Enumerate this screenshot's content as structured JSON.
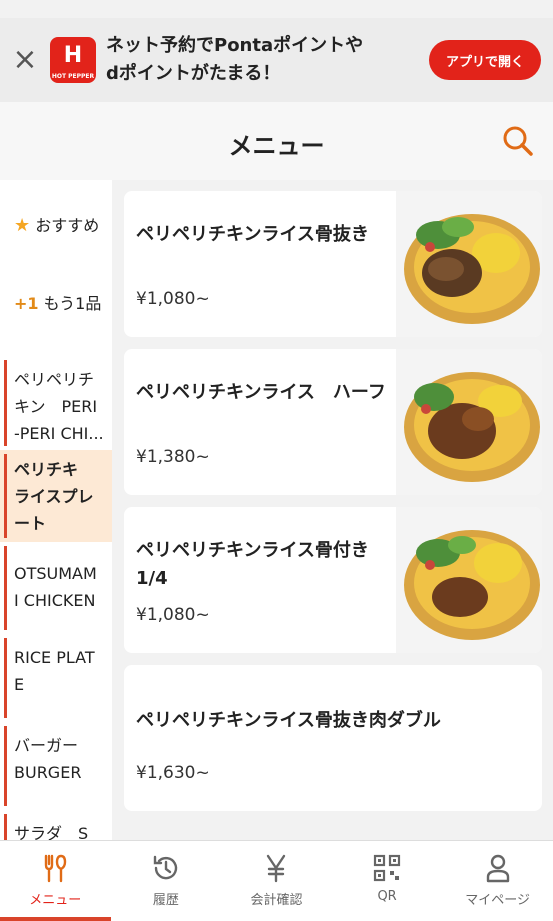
{
  "banner": {
    "app_icon_letter": "H",
    "app_icon_sub": "HOT PEPPER",
    "message_line1": "ネット予約でPontaポイントや",
    "message_line2": "dポイントがたまる！",
    "open_app_label": "アプリで開く",
    "close_glyph": "×"
  },
  "header": {
    "title": "メニュー"
  },
  "sidebar": {
    "recommend": "おすすめ",
    "one_more_prefix": "+1",
    "one_more": "もう1品",
    "items": [
      {
        "line1": "ペリペリチ",
        "line2": "キン　PERI",
        "line3": "-PERI CHI..."
      },
      {
        "line1": "ペリチキ",
        "line2": "ライスプレ",
        "line3": "ート"
      },
      {
        "line1": "OTSUMAM",
        "line2": "I CHICKEN"
      },
      {
        "line1": "RICE PLAT",
        "line2": "E"
      },
      {
        "line1": "バーガー",
        "line2": "BURGER"
      },
      {
        "line1": "サラダ　S"
      }
    ]
  },
  "menu": [
    {
      "name": "ペリペリチキンライス骨抜き",
      "price": "¥1,080~"
    },
    {
      "name": "ペリペリチキンライス　ハーフ",
      "price": "¥1,380~"
    },
    {
      "name": "ペリペリチキンライス骨付き1/4",
      "price": "¥1,080~"
    },
    {
      "name": "ペリペリチキンライス骨抜き肉ダブル",
      "price": "¥1,630~"
    }
  ],
  "bottom_nav": [
    {
      "label": "メニュー",
      "icon": "fork-knife-icon",
      "active": true
    },
    {
      "label": "履歴",
      "icon": "history-icon"
    },
    {
      "label": "会計確認",
      "icon": "yen-icon"
    },
    {
      "label": "QR",
      "icon": "qr-code-icon"
    },
    {
      "label": "マイページ",
      "icon": "person-icon"
    }
  ],
  "colors": {
    "accent": "#e2231a",
    "highlight": "#fde9d5",
    "nav_active": "#d9442a"
  }
}
